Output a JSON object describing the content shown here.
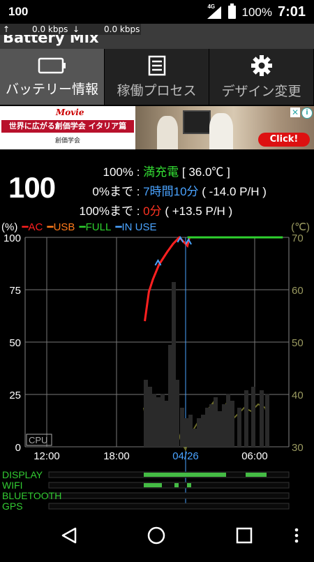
{
  "status": {
    "left_text": "100",
    "network": "4G",
    "battery_pct": "100%",
    "time": "7:01"
  },
  "app": {
    "title": "Battery Mix",
    "upload_speed": "0.0 kbps",
    "download_speed": "0.0 kbps"
  },
  "tabs": [
    {
      "label": "バッテリー情報",
      "icon": "battery-icon",
      "active": true
    },
    {
      "label": "稼働プロセス",
      "icon": "list-icon",
      "active": false
    },
    {
      "label": "デザイン変更",
      "icon": "gear-icon",
      "active": false
    }
  ],
  "ad": {
    "movie": "Movie",
    "headline": "世界に広がる創価学会 イタリア篇",
    "org": "創価学会",
    "button": "Click!",
    "info": "i",
    "close": "✕"
  },
  "battery": {
    "level": "100",
    "line1_key": "100%",
    "line1_sep": " : ",
    "line1_status": "満充電",
    "line1_temp": " [ 36.0℃ ]",
    "line2_key": "0%まで",
    "line2_sep": " : ",
    "line2_time": "7時間10分",
    "line2_rate": " ( -14.0 P/H )",
    "line3_key": "100%まで",
    "line3_sep": " : ",
    "line3_time": "0分",
    "line3_rate": " ( +13.5 P/H )"
  },
  "legend": {
    "unit_left": "(%)",
    "ac": "━AC",
    "usb": "━USB",
    "full": "━FULL",
    "in_use": "━IN USE",
    "unit_right": "(℃)"
  },
  "colors": {
    "ac": "#ff2020",
    "usb": "#ff7a1a",
    "full": "#2ed12e",
    "in_use": "#4aa3ff",
    "temp": "#6d6d2a",
    "right_axis": "#9a9a60"
  },
  "chart_data": {
    "type": "line",
    "y_left_ticks": [
      "100",
      "75",
      "50",
      "25",
      "0"
    ],
    "y_right_ticks": [
      "70",
      "60",
      "50",
      "40",
      "30"
    ],
    "x_ticks": [
      "12:00",
      "18:00",
      "04/26",
      "06:00"
    ],
    "cpu_label": "CPU",
    "ylim": [
      0,
      100
    ],
    "y_right_lim": [
      30,
      70
    ],
    "series": [
      {
        "name": "AC",
        "x": [
          5.9,
          6.1,
          6.3,
          6.6,
          7.0,
          7.3,
          7.6,
          8.0,
          8.1
        ],
        "values": [
          60,
          74,
          80,
          87,
          93,
          97,
          100,
          96,
          100
        ]
      },
      {
        "name": "FULL",
        "x": [
          8.0,
          9.1,
          10.3,
          11.5,
          12.7
        ],
        "values": [
          100,
          100,
          100,
          100,
          100
        ]
      }
    ],
    "activity_rows": [
      "DISPLAY",
      "WIFI",
      "BLUETOOTH",
      "GPS"
    ]
  },
  "nav": {
    "back": "back-icon",
    "home": "home-icon",
    "recents": "recents-icon",
    "menu": "menu-icon"
  }
}
